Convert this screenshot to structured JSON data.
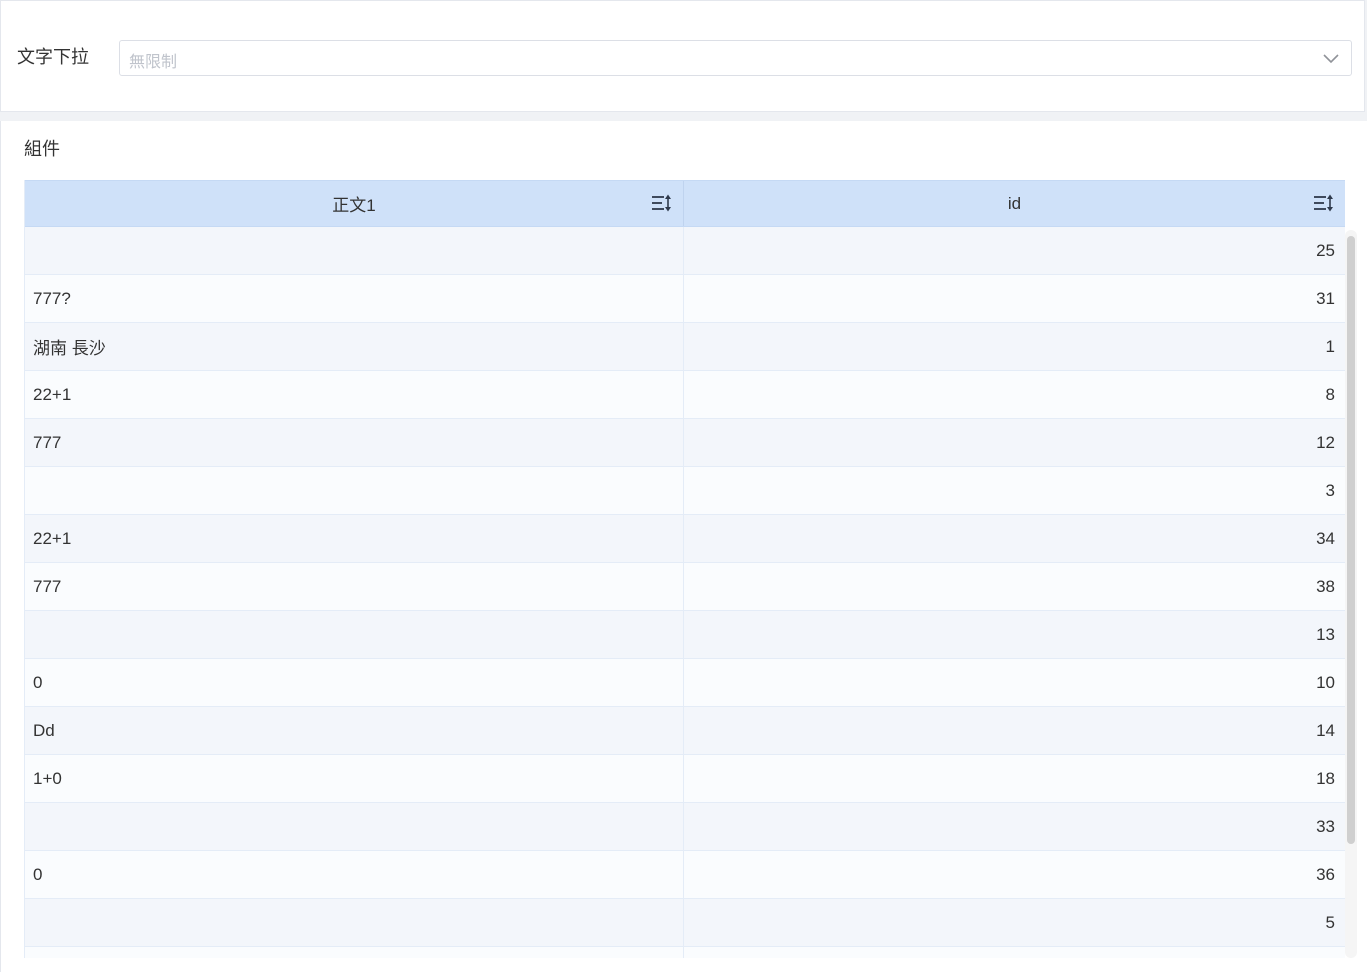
{
  "filter": {
    "label": "文字下拉",
    "select_value": "無限制"
  },
  "component": {
    "title": "組件",
    "table": {
      "columns": [
        {
          "label": "正文1",
          "sort_icon": "sort-icon"
        },
        {
          "label": "id",
          "sort_icon": "sort-icon"
        }
      ],
      "rows": [
        {
          "text": "",
          "id": "25"
        },
        {
          "text": "777?",
          "id": "31"
        },
        {
          "text": "湖南 長沙",
          "id": "1"
        },
        {
          "text": "22+1",
          "id": "8"
        },
        {
          "text": "777",
          "id": "12"
        },
        {
          "text": "",
          "id": "3"
        },
        {
          "text": "22+1",
          "id": "34"
        },
        {
          "text": "777",
          "id": "38"
        },
        {
          "text": "",
          "id": "13"
        },
        {
          "text": "0",
          "id": "10"
        },
        {
          "text": "Dd",
          "id": "14"
        },
        {
          "text": "1+0",
          "id": "18"
        },
        {
          "text": "",
          "id": "33"
        },
        {
          "text": "0",
          "id": "36"
        },
        {
          "text": "",
          "id": "5"
        },
        {
          "text": "",
          "id": ""
        }
      ]
    }
  },
  "colors": {
    "header_bg": "#cfe1f9",
    "row_even": "#f3f6fb",
    "row_odd": "#fafcfe",
    "placeholder": "#c0c4cc"
  }
}
